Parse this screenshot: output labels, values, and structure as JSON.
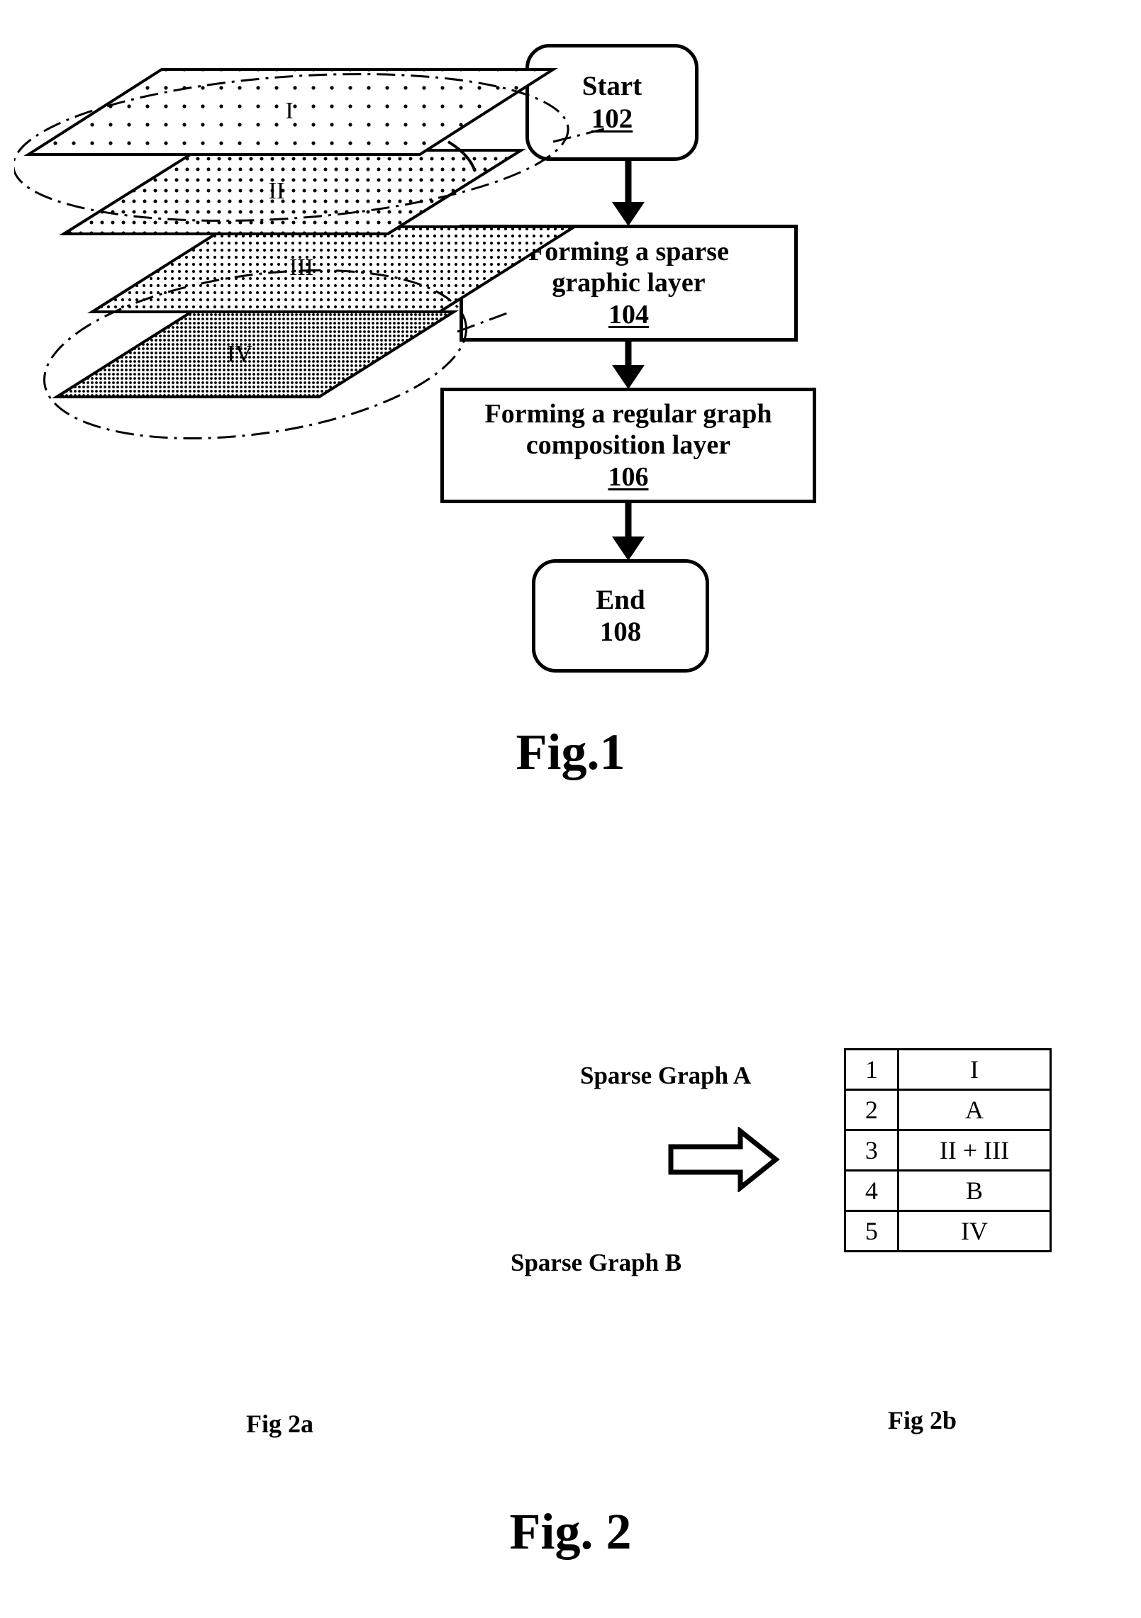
{
  "figure1": {
    "caption": "Fig.1",
    "nodes": [
      {
        "id": "start",
        "label": "Start",
        "number": "102",
        "underlined": true
      },
      {
        "id": "step104",
        "line1": "Forming a sparse",
        "line2": "graphic layer",
        "number": "104",
        "underlined": true
      },
      {
        "id": "step106",
        "line1": "Forming a regular graph",
        "line2": "composition layer",
        "number": "106",
        "underlined": true
      },
      {
        "id": "end",
        "label": "End",
        "number": "108",
        "underlined": false
      }
    ]
  },
  "figure2": {
    "caption": "Fig. 2",
    "sub_a": {
      "caption": "Fig 2a",
      "layer_labels": [
        "I",
        "II",
        "III",
        "IV"
      ],
      "callouts": [
        {
          "name": "sparse-graph-a",
          "text": "Sparse Graph A"
        },
        {
          "name": "sparse-graph-b",
          "text": "Sparse Graph B"
        }
      ]
    },
    "sub_b": {
      "caption": "Fig 2b",
      "rows": [
        {
          "index": "1",
          "value": "I"
        },
        {
          "index": "2",
          "value": "A"
        },
        {
          "index": "3",
          "value": "II + III"
        },
        {
          "index": "4",
          "value": "B"
        },
        {
          "index": "5",
          "value": "IV"
        }
      ]
    },
    "transform_arrow": "right-arrow-icon"
  },
  "colors": {
    "ink": "#000000",
    "page": "#ffffff"
  }
}
